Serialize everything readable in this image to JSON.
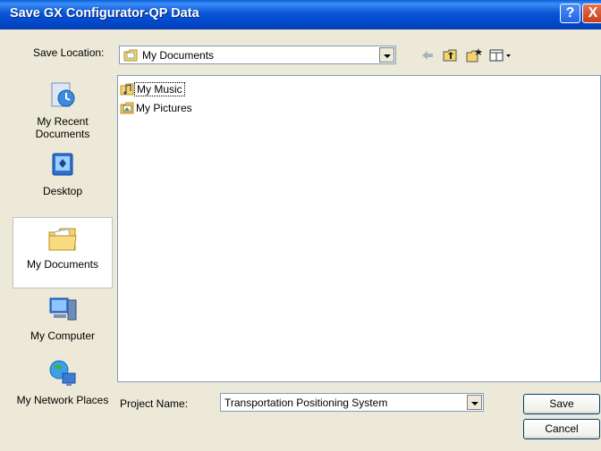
{
  "window": {
    "title": "Save GX Configurator-QP Data",
    "help_glyph": "?",
    "close_glyph": "X"
  },
  "toolbar": {
    "save_location_label": "Save Location:",
    "save_location_value": "My Documents",
    "icons": [
      "back-arrow-icon",
      "up-folder-icon",
      "new-folder-icon",
      "views-menu-icon"
    ]
  },
  "places": [
    {
      "label": "My Recent Documents",
      "icon": "recent-documents-icon"
    },
    {
      "label": "Desktop",
      "icon": "desktop-icon"
    },
    {
      "label": "My Documents",
      "icon": "my-documents-icon",
      "selected": true
    },
    {
      "label": "My Computer",
      "icon": "my-computer-icon"
    },
    {
      "label": "My Network Places",
      "icon": "network-places-icon"
    }
  ],
  "files": [
    {
      "name": "My Music",
      "icon": "music-folder-icon"
    },
    {
      "name": "My Pictures",
      "icon": "pictures-folder-icon"
    }
  ],
  "footer": {
    "project_name_label": "Project Name:",
    "project_name_value": "Transportation Positioning System",
    "save_label": "Save",
    "cancel_label": "Cancel"
  },
  "colors": {
    "title_bar": "#0a55d6",
    "dialog_bg": "#ece9d8",
    "field_border": "#7f9db9"
  }
}
